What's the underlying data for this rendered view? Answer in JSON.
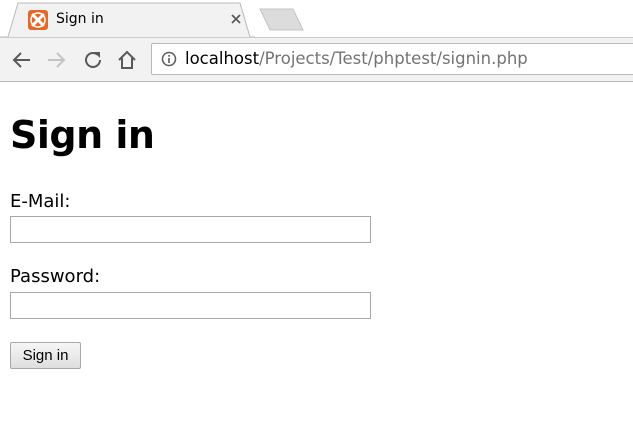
{
  "tab": {
    "title": "Sign in",
    "favicon": "xampp-favicon-icon",
    "favicon_color": "#e3682a"
  },
  "toolbar": {
    "back": "back-arrow-icon",
    "forward": "forward-arrow-icon",
    "reload": "reload-icon",
    "home": "home-icon"
  },
  "omnibox": {
    "host": "localhost",
    "path": "/Projects/Test/phptest/signin.php"
  },
  "page": {
    "heading": "Sign in",
    "email_label": "E-Mail:",
    "email_value": "",
    "password_label": "Password:",
    "password_value": "",
    "submit_label": "Sign in"
  }
}
